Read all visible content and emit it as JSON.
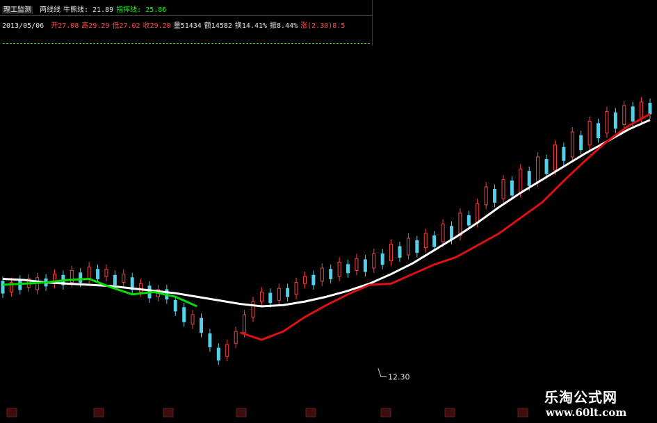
{
  "header": {
    "indicator_name": "理工监测",
    "labels": [
      {
        "text": "两线线",
        "color": "#e6e6e6"
      },
      {
        "text": "牛熊线: 21.89",
        "color": "#e6e6e6"
      },
      {
        "text": "指挥线: 25.86",
        "color": "#00ff00"
      }
    ],
    "date": "2013/05/06",
    "quote_fields": [
      {
        "text": "开27.08",
        "color": "#ff4a4a"
      },
      {
        "text": "高29.29",
        "color": "#ff4a4a"
      },
      {
        "text": "低27.02",
        "color": "#ff4a4a"
      },
      {
        "text": "收29.20",
        "color": "#ff4a4a"
      },
      {
        "text": "量51434",
        "color": "#e6e6e6"
      },
      {
        "text": "额14582",
        "color": "#e6e6e6"
      },
      {
        "text": "换14.41%",
        "color": "#e6e6e6"
      },
      {
        "text": "振8.44%",
        "color": "#e6e6e6"
      },
      {
        "text": "涨(2.30)8.5",
        "color": "#ff4a4a"
      }
    ]
  },
  "watermark": {
    "title": "乐淘公式网",
    "url": "www.60lt.com"
  },
  "chart_data": {
    "type": "line",
    "title": "",
    "x": [
      0,
      5,
      10,
      15,
      20,
      25,
      30,
      35,
      40,
      45,
      50,
      55,
      60,
      65,
      70,
      75,
      80,
      85,
      90,
      95,
      100,
      105,
      110,
      115,
      120,
      125,
      130,
      135,
      140,
      145,
      150
    ],
    "ylim": [
      10,
      35
    ],
    "annotations": [
      {
        "text": "12.30",
        "x": 87,
        "y": 12.3
      }
    ],
    "series": [
      {
        "name": "牛熊线",
        "color": "#ffffff",
        "values": [
          19.8,
          19.7,
          19.5,
          19.4,
          19.3,
          19.2,
          19.0,
          18.8,
          18.6,
          18.3,
          18.0,
          17.7,
          17.5,
          17.6,
          17.9,
          18.3,
          18.8,
          19.4,
          20.2,
          21.1,
          22.2,
          23.3,
          24.5,
          25.8,
          27.0,
          28.1,
          29.2,
          30.3,
          31.3,
          32.3,
          33.1
        ],
        "segment_colors": [
          "#ffffff"
        ]
      },
      {
        "name": "指挥线",
        "color": "#00dd00",
        "values": [
          19.3,
          19.4,
          19.5,
          19.7,
          19.8,
          19.1,
          18.5,
          18.7,
          18.3,
          17.5,
          16.5,
          15.3,
          14.7,
          15.4,
          16.6,
          17.6,
          18.5,
          19.3,
          19.4,
          20.2,
          21.0,
          21.6,
          22.6,
          23.6,
          24.9,
          26.2,
          28.0,
          29.7,
          31.3,
          32.6,
          33.6
        ],
        "color_changes": [
          {
            "from": 0,
            "color": "#00dd00"
          },
          {
            "from": 47,
            "color": "#ffd700"
          },
          {
            "from": 53,
            "color": "#dd1111"
          }
        ]
      }
    ],
    "candles": [
      {
        "x": 0,
        "open": 19.6,
        "close": 18.6
      },
      {
        "x": 2,
        "open": 18.7,
        "close": 19.5
      },
      {
        "x": 4,
        "open": 19.7,
        "close": 18.9
      },
      {
        "x": 6,
        "open": 19.1,
        "close": 19.8
      },
      {
        "x": 8,
        "open": 18.9,
        "close": 19.9
      },
      {
        "x": 10,
        "open": 19.8,
        "close": 19.2
      },
      {
        "x": 12,
        "open": 19.4,
        "close": 20.2
      },
      {
        "x": 14,
        "open": 20.1,
        "close": 19.3
      },
      {
        "x": 16,
        "open": 19.5,
        "close": 20.5
      },
      {
        "x": 18,
        "open": 20.3,
        "close": 19.5
      },
      {
        "x": 20,
        "open": 19.8,
        "close": 20.8
      },
      {
        "x": 22,
        "open": 20.6,
        "close": 19.8
      },
      {
        "x": 24,
        "open": 20.0,
        "close": 20.6
      },
      {
        "x": 26,
        "open": 20.1,
        "close": 19.3
      },
      {
        "x": 28,
        "open": 19.5,
        "close": 20.2
      },
      {
        "x": 30,
        "open": 19.9,
        "close": 18.9
      },
      {
        "x": 32,
        "open": 18.7,
        "close": 19.4
      },
      {
        "x": 34,
        "open": 19.2,
        "close": 18.2
      },
      {
        "x": 36,
        "open": 18.3,
        "close": 18.9
      },
      {
        "x": 38,
        "open": 18.9,
        "close": 18.1
      },
      {
        "x": 40,
        "open": 18.0,
        "close": 17.1
      },
      {
        "x": 42,
        "open": 17.4,
        "close": 16.2
      },
      {
        "x": 44,
        "open": 16.0,
        "close": 16.8
      },
      {
        "x": 46,
        "open": 16.5,
        "close": 15.3
      },
      {
        "x": 48,
        "open": 15.2,
        "close": 14.1
      },
      {
        "x": 50,
        "open": 14.0,
        "close": 13.0
      },
      {
        "x": 52,
        "open": 13.3,
        "close": 14.3
      },
      {
        "x": 54,
        "open": 14.4,
        "close": 15.4
      },
      {
        "x": 56,
        "open": 15.3,
        "close": 16.8
      },
      {
        "x": 58,
        "open": 16.6,
        "close": 17.9
      },
      {
        "x": 60,
        "open": 17.9,
        "close": 18.7
      },
      {
        "x": 62,
        "open": 18.6,
        "close": 17.8
      },
      {
        "x": 64,
        "open": 18.0,
        "close": 19.0
      },
      {
        "x": 66,
        "open": 19.0,
        "close": 18.3
      },
      {
        "x": 68,
        "open": 18.5,
        "close": 19.5
      },
      {
        "x": 70,
        "open": 19.4,
        "close": 20.0
      },
      {
        "x": 72,
        "open": 20.1,
        "close": 19.3
      },
      {
        "x": 74,
        "open": 19.6,
        "close": 20.7
      },
      {
        "x": 76,
        "open": 20.6,
        "close": 19.8
      },
      {
        "x": 78,
        "open": 20.0,
        "close": 21.2
      },
      {
        "x": 80,
        "open": 21.0,
        "close": 20.3
      },
      {
        "x": 82,
        "open": 20.5,
        "close": 21.5
      },
      {
        "x": 84,
        "open": 21.4,
        "close": 20.4
      },
      {
        "x": 86,
        "open": 20.7,
        "close": 21.9
      },
      {
        "x": 88,
        "open": 21.9,
        "close": 21.0
      },
      {
        "x": 90,
        "open": 21.3,
        "close": 22.7
      },
      {
        "x": 92,
        "open": 22.5,
        "close": 21.6
      },
      {
        "x": 94,
        "open": 21.8,
        "close": 23.2
      },
      {
        "x": 96,
        "open": 23.0,
        "close": 22.0
      },
      {
        "x": 98,
        "open": 22.4,
        "close": 23.6
      },
      {
        "x": 100,
        "open": 23.4,
        "close": 22.5
      },
      {
        "x": 102,
        "open": 22.9,
        "close": 24.4
      },
      {
        "x": 104,
        "open": 24.2,
        "close": 23.1
      },
      {
        "x": 106,
        "open": 23.4,
        "close": 25.3
      },
      {
        "x": 108,
        "open": 25.1,
        "close": 24.3
      },
      {
        "x": 110,
        "open": 24.5,
        "close": 26.1
      },
      {
        "x": 112,
        "open": 26.0,
        "close": 27.5
      },
      {
        "x": 114,
        "open": 27.3,
        "close": 26.2
      },
      {
        "x": 116,
        "open": 26.5,
        "close": 28.1
      },
      {
        "x": 118,
        "open": 28.0,
        "close": 26.8
      },
      {
        "x": 120,
        "open": 27.0,
        "close": 29.0
      },
      {
        "x": 122,
        "open": 28.8,
        "close": 27.6
      },
      {
        "x": 124,
        "open": 27.9,
        "close": 30.0
      },
      {
        "x": 126,
        "open": 29.8,
        "close": 28.6
      },
      {
        "x": 128,
        "open": 28.9,
        "close": 31.0
      },
      {
        "x": 130,
        "open": 30.8,
        "close": 29.7
      },
      {
        "x": 132,
        "open": 30.0,
        "close": 32.1
      },
      {
        "x": 134,
        "open": 31.8,
        "close": 30.6
      },
      {
        "x": 136,
        "open": 31.0,
        "close": 33.0
      },
      {
        "x": 138,
        "open": 32.8,
        "close": 31.6
      },
      {
        "x": 140,
        "open": 32.0,
        "close": 33.8
      },
      {
        "x": 142,
        "open": 33.7,
        "close": 32.4
      },
      {
        "x": 144,
        "open": 32.7,
        "close": 34.3
      },
      {
        "x": 146,
        "open": 34.2,
        "close": 33.0
      },
      {
        "x": 148,
        "open": 33.2,
        "close": 34.6
      },
      {
        "x": 150,
        "open": 34.5,
        "close": 33.6
      }
    ],
    "grid": false,
    "legend": "none"
  }
}
